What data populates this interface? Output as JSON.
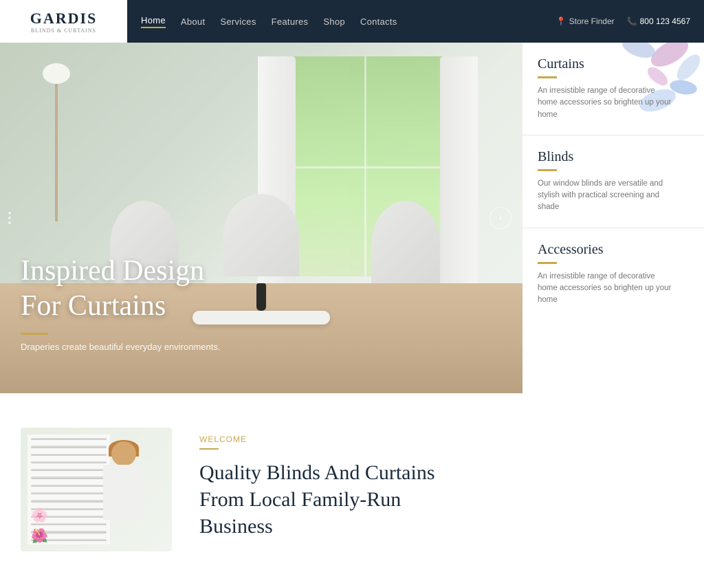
{
  "brand": {
    "name": "GARDIS",
    "tagline": "Blinds & Curtains"
  },
  "nav": {
    "links": [
      {
        "label": "Home",
        "active": true
      },
      {
        "label": "About",
        "active": false
      },
      {
        "label": "Services",
        "active": false
      },
      {
        "label": "Features",
        "active": false
      },
      {
        "label": "Shop",
        "active": false
      },
      {
        "label": "Contacts",
        "active": false
      }
    ],
    "store_finder": "Store Finder",
    "phone": "800 123 4567"
  },
  "hero": {
    "title": "Inspired Design\nFor Curtains",
    "subtitle": "Draperies create beautiful everyday environments.",
    "slide_arrow": "‹"
  },
  "sidebar": {
    "items": [
      {
        "title": "Curtains",
        "description": "An irresistible range of decorative home accessories so brighten up your home"
      },
      {
        "title": "Blinds",
        "description": "Our window blinds are versatile and stylish with practical screening and shade"
      },
      {
        "title": "Accessories",
        "description": "An irresistible range of decorative home accessories so brighten up your home"
      }
    ]
  },
  "lower": {
    "welcome_label": "Welcome",
    "title_line1": "Quality Blinds And Curtains",
    "title_line2": "From Local Family-Run",
    "title_line3": "Business"
  }
}
